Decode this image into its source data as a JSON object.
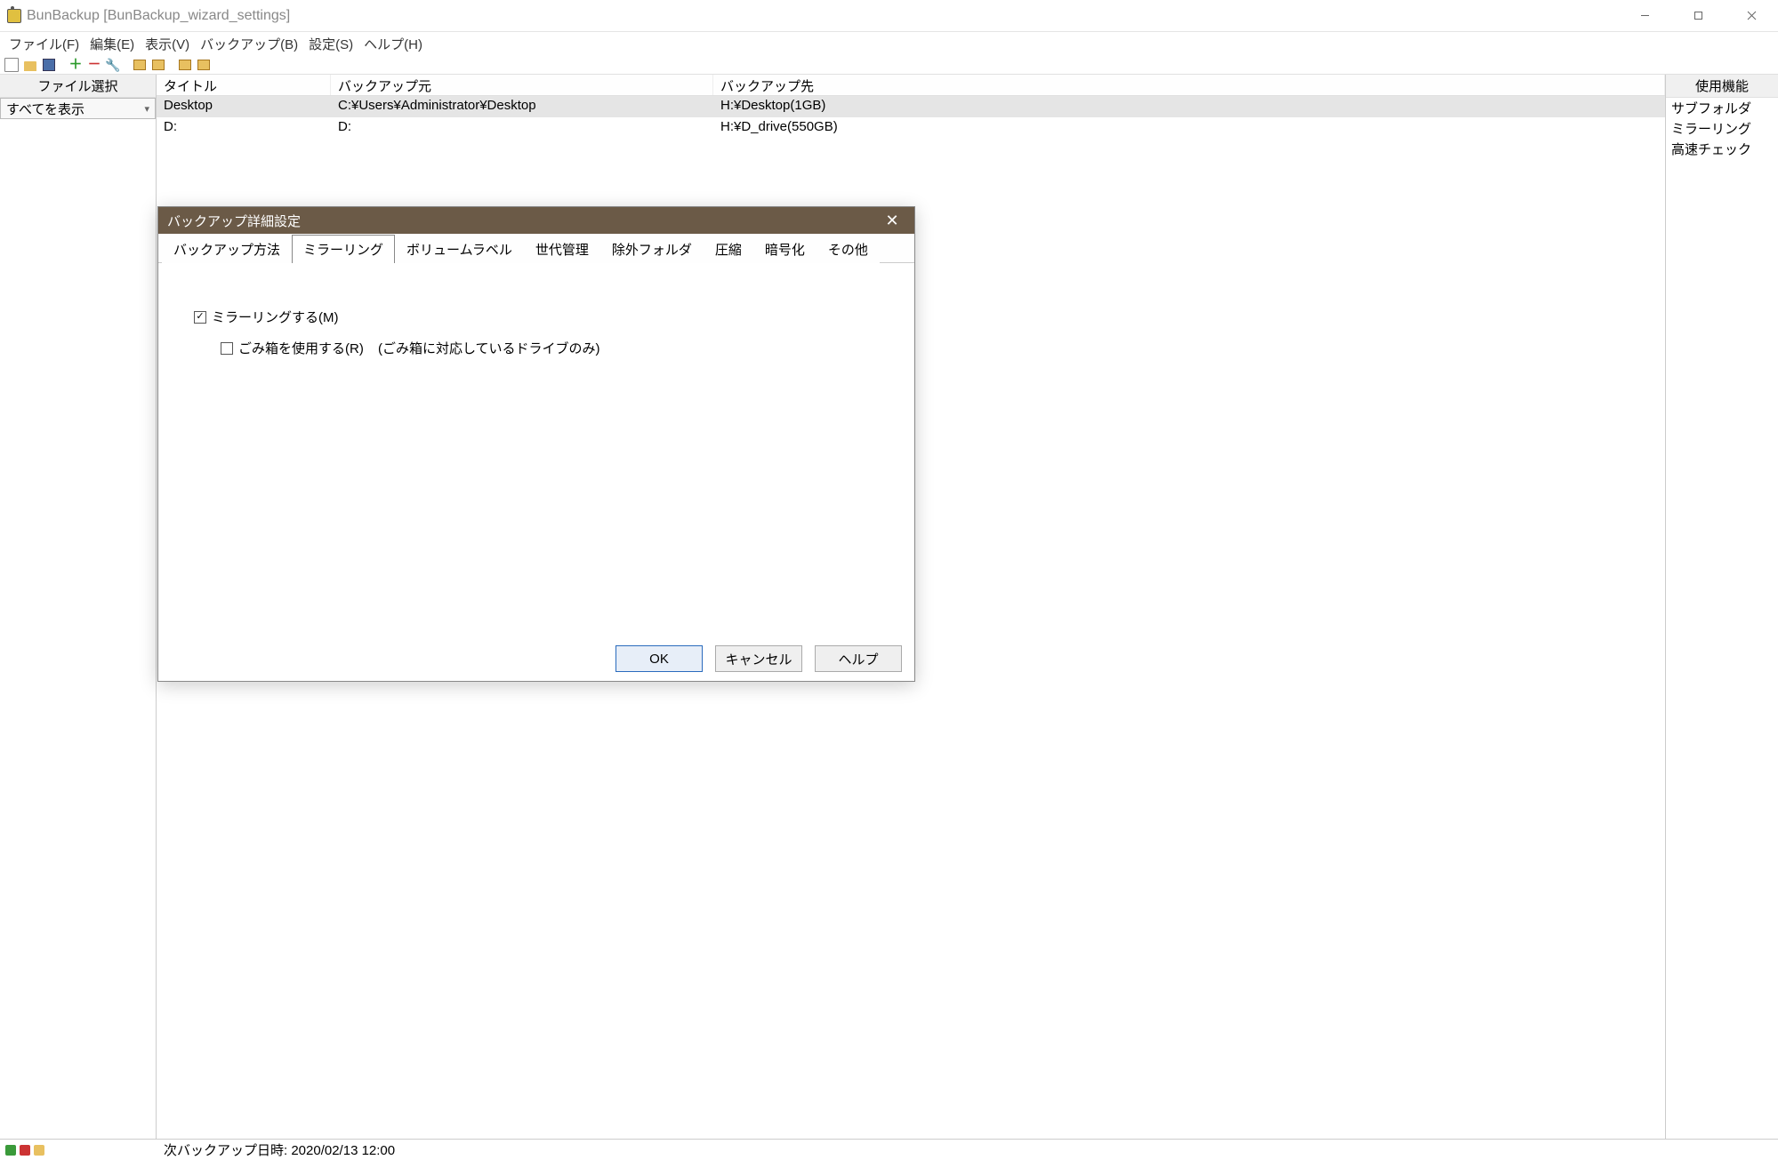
{
  "window": {
    "title": "BunBackup [BunBackup_wizard_settings]"
  },
  "menu": {
    "file": "ファイル(F)",
    "edit": "編集(E)",
    "view": "表示(V)",
    "backup": "バックアップ(B)",
    "settings": "設定(S)",
    "help": "ヘルプ(H)"
  },
  "panels": {
    "file_select_header": "ファイル選択",
    "file_select_value": "すべてを表示",
    "features_header": "使用機能",
    "features": [
      "サブフォルダ",
      "ミラーリング",
      "高速チェック"
    ]
  },
  "table": {
    "columns": {
      "title": "タイトル",
      "source": "バックアップ元",
      "dest": "バックアップ先"
    },
    "rows": [
      {
        "title": "Desktop",
        "source": "C:¥Users¥Administrator¥Desktop",
        "dest": "H:¥Desktop(1GB)"
      },
      {
        "title": "D:",
        "source": "D:",
        "dest": "H:¥D_drive(550GB)"
      }
    ]
  },
  "dialog": {
    "title": "バックアップ詳細設定",
    "tabs": [
      "バックアップ方法",
      "ミラーリング",
      "ボリュームラベル",
      "世代管理",
      "除外フォルダ",
      "圧縮",
      "暗号化",
      "その他"
    ],
    "active_tab": 1,
    "mirroring_label": "ミラーリングする(M)",
    "mirroring_checked": true,
    "recycle_label": "ごみ箱を使用する(R)",
    "recycle_checked": false,
    "recycle_note": "(ごみ箱に対応しているドライブのみ)",
    "buttons": {
      "ok": "OK",
      "cancel": "キャンセル",
      "help": "ヘルプ"
    }
  },
  "status": {
    "next_backup": "次バックアップ日時: 2020/02/13 12:00"
  }
}
